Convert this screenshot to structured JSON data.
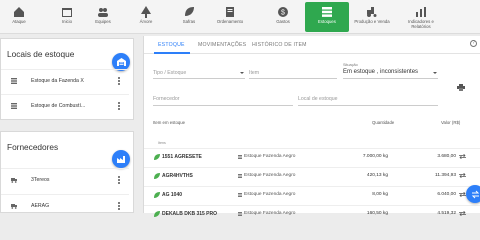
{
  "nav": [
    {
      "label": "Ataque",
      "icon": "home-icon"
    },
    {
      "label": "Inicio",
      "icon": "calendar-icon"
    },
    {
      "label": "Equipes",
      "icon": "people-icon"
    },
    {
      "label": "Árvore",
      "icon": "tree-icon"
    },
    {
      "label": "Safras",
      "icon": "leaf-icon"
    },
    {
      "label": "Ordenamento",
      "icon": "document-icon"
    },
    {
      "label": "Gastos",
      "icon": "money-icon"
    },
    {
      "label": "Estoques",
      "icon": "stack-icon"
    },
    {
      "label": "Produção e Venda",
      "icon": "tractor-icon"
    },
    {
      "label": "Indicadores e Relatórios",
      "icon": "chart-icon"
    }
  ],
  "locais": {
    "title": "Locais de estoque",
    "items": [
      "Estoque da Fazenda X",
      "Estoque de Combustí..."
    ]
  },
  "fornecedores": {
    "title": "Fornecedores",
    "items": [
      "3Tereos",
      "AERAG"
    ]
  },
  "tabs": [
    "ESTOQUE",
    "MOVIMENTAÇÕES",
    "HISTÓRICO DE ITEM"
  ],
  "filters": {
    "tipo_placeholder": "Tipo / Estoque",
    "item_placeholder": "Item",
    "situacao_label": "Situação",
    "situacao_value": "Em estoque , inconsistentes",
    "fornecedor_placeholder": "Fornecedor",
    "local_placeholder": "Local de estoque"
  },
  "table": {
    "headers": {
      "item": "Item em estoque",
      "qty": "Quantidade",
      "val": "Valor (R$)"
    },
    "group_label": "Itens",
    "rows": [
      {
        "name": "1551 AGRESETE",
        "stock": "Estoque Fazenda Aegro",
        "qty": "7.000,00 kg",
        "val": "3.680,00"
      },
      {
        "name": "AGR4HVTHS",
        "stock": "Estoque Fazenda Aegro",
        "qty": "420,13 kg",
        "val": "11.394,93"
      },
      {
        "name": "AG 1040",
        "stock": "Estoque Fazenda Aegro",
        "qty": "8,00 kg",
        "val": "6.040,00"
      },
      {
        "name": "DEKALB DKB 315 PRO",
        "stock": "Estoque Fazenda Aegro",
        "qty": "160,50 kg",
        "val": "4.519,32"
      }
    ]
  },
  "colors": {
    "accent": "#2d7ff9",
    "active_nav": "#2fa84f",
    "leaf": "#4caf50"
  }
}
